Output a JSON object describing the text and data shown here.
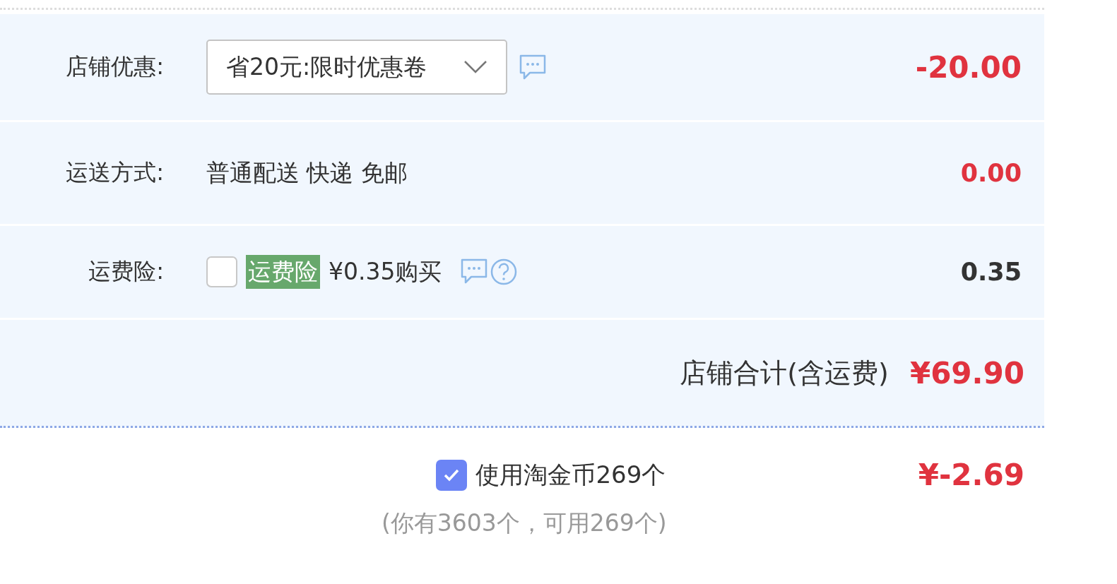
{
  "rows": [
    {
      "kind": "select",
      "label": "店铺优惠:",
      "value": "省20元:限时优惠卷",
      "amount": "-20.00",
      "highlighted": true
    },
    {
      "kind": "text",
      "label": "运送方式:",
      "value": "普通配送 快递 免邮",
      "amount": "0.00",
      "highlighted": true
    },
    {
      "kind": "insurance",
      "label": "运费险:",
      "checked": false,
      "badge": "运费险",
      "value": "¥0.35购买",
      "amount": "0.35",
      "highlighted": false
    }
  ],
  "total": {
    "label": "店铺合计(含运费)",
    "amount": "¥69.90"
  },
  "coins": {
    "checked": true,
    "label": "使用淘金币269个",
    "amount": "¥-2.69",
    "note": "(你有3603个，可用269个)"
  }
}
